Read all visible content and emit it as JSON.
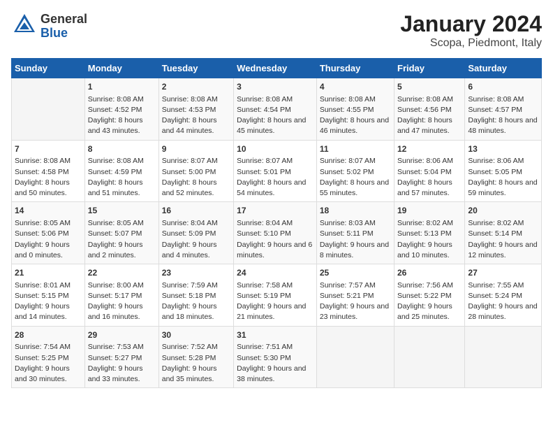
{
  "logo": {
    "general": "General",
    "blue": "Blue"
  },
  "title": "January 2024",
  "subtitle": "Scopa, Piedmont, Italy",
  "days_of_week": [
    "Sunday",
    "Monday",
    "Tuesday",
    "Wednesday",
    "Thursday",
    "Friday",
    "Saturday"
  ],
  "weeks": [
    [
      {
        "day": "",
        "sunrise": "",
        "sunset": "",
        "daylight": ""
      },
      {
        "day": "1",
        "sunrise": "Sunrise: 8:08 AM",
        "sunset": "Sunset: 4:52 PM",
        "daylight": "Daylight: 8 hours and 43 minutes."
      },
      {
        "day": "2",
        "sunrise": "Sunrise: 8:08 AM",
        "sunset": "Sunset: 4:53 PM",
        "daylight": "Daylight: 8 hours and 44 minutes."
      },
      {
        "day": "3",
        "sunrise": "Sunrise: 8:08 AM",
        "sunset": "Sunset: 4:54 PM",
        "daylight": "Daylight: 8 hours and 45 minutes."
      },
      {
        "day": "4",
        "sunrise": "Sunrise: 8:08 AM",
        "sunset": "Sunset: 4:55 PM",
        "daylight": "Daylight: 8 hours and 46 minutes."
      },
      {
        "day": "5",
        "sunrise": "Sunrise: 8:08 AM",
        "sunset": "Sunset: 4:56 PM",
        "daylight": "Daylight: 8 hours and 47 minutes."
      },
      {
        "day": "6",
        "sunrise": "Sunrise: 8:08 AM",
        "sunset": "Sunset: 4:57 PM",
        "daylight": "Daylight: 8 hours and 48 minutes."
      }
    ],
    [
      {
        "day": "7",
        "sunrise": "Sunrise: 8:08 AM",
        "sunset": "Sunset: 4:58 PM",
        "daylight": "Daylight: 8 hours and 50 minutes."
      },
      {
        "day": "8",
        "sunrise": "Sunrise: 8:08 AM",
        "sunset": "Sunset: 4:59 PM",
        "daylight": "Daylight: 8 hours and 51 minutes."
      },
      {
        "day": "9",
        "sunrise": "Sunrise: 8:07 AM",
        "sunset": "Sunset: 5:00 PM",
        "daylight": "Daylight: 8 hours and 52 minutes."
      },
      {
        "day": "10",
        "sunrise": "Sunrise: 8:07 AM",
        "sunset": "Sunset: 5:01 PM",
        "daylight": "Daylight: 8 hours and 54 minutes."
      },
      {
        "day": "11",
        "sunrise": "Sunrise: 8:07 AM",
        "sunset": "Sunset: 5:02 PM",
        "daylight": "Daylight: 8 hours and 55 minutes."
      },
      {
        "day": "12",
        "sunrise": "Sunrise: 8:06 AM",
        "sunset": "Sunset: 5:04 PM",
        "daylight": "Daylight: 8 hours and 57 minutes."
      },
      {
        "day": "13",
        "sunrise": "Sunrise: 8:06 AM",
        "sunset": "Sunset: 5:05 PM",
        "daylight": "Daylight: 8 hours and 59 minutes."
      }
    ],
    [
      {
        "day": "14",
        "sunrise": "Sunrise: 8:05 AM",
        "sunset": "Sunset: 5:06 PM",
        "daylight": "Daylight: 9 hours and 0 minutes."
      },
      {
        "day": "15",
        "sunrise": "Sunrise: 8:05 AM",
        "sunset": "Sunset: 5:07 PM",
        "daylight": "Daylight: 9 hours and 2 minutes."
      },
      {
        "day": "16",
        "sunrise": "Sunrise: 8:04 AM",
        "sunset": "Sunset: 5:09 PM",
        "daylight": "Daylight: 9 hours and 4 minutes."
      },
      {
        "day": "17",
        "sunrise": "Sunrise: 8:04 AM",
        "sunset": "Sunset: 5:10 PM",
        "daylight": "Daylight: 9 hours and 6 minutes."
      },
      {
        "day": "18",
        "sunrise": "Sunrise: 8:03 AM",
        "sunset": "Sunset: 5:11 PM",
        "daylight": "Daylight: 9 hours and 8 minutes."
      },
      {
        "day": "19",
        "sunrise": "Sunrise: 8:02 AM",
        "sunset": "Sunset: 5:13 PM",
        "daylight": "Daylight: 9 hours and 10 minutes."
      },
      {
        "day": "20",
        "sunrise": "Sunrise: 8:02 AM",
        "sunset": "Sunset: 5:14 PM",
        "daylight": "Daylight: 9 hours and 12 minutes."
      }
    ],
    [
      {
        "day": "21",
        "sunrise": "Sunrise: 8:01 AM",
        "sunset": "Sunset: 5:15 PM",
        "daylight": "Daylight: 9 hours and 14 minutes."
      },
      {
        "day": "22",
        "sunrise": "Sunrise: 8:00 AM",
        "sunset": "Sunset: 5:17 PM",
        "daylight": "Daylight: 9 hours and 16 minutes."
      },
      {
        "day": "23",
        "sunrise": "Sunrise: 7:59 AM",
        "sunset": "Sunset: 5:18 PM",
        "daylight": "Daylight: 9 hours and 18 minutes."
      },
      {
        "day": "24",
        "sunrise": "Sunrise: 7:58 AM",
        "sunset": "Sunset: 5:19 PM",
        "daylight": "Daylight: 9 hours and 21 minutes."
      },
      {
        "day": "25",
        "sunrise": "Sunrise: 7:57 AM",
        "sunset": "Sunset: 5:21 PM",
        "daylight": "Daylight: 9 hours and 23 minutes."
      },
      {
        "day": "26",
        "sunrise": "Sunrise: 7:56 AM",
        "sunset": "Sunset: 5:22 PM",
        "daylight": "Daylight: 9 hours and 25 minutes."
      },
      {
        "day": "27",
        "sunrise": "Sunrise: 7:55 AM",
        "sunset": "Sunset: 5:24 PM",
        "daylight": "Daylight: 9 hours and 28 minutes."
      }
    ],
    [
      {
        "day": "28",
        "sunrise": "Sunrise: 7:54 AM",
        "sunset": "Sunset: 5:25 PM",
        "daylight": "Daylight: 9 hours and 30 minutes."
      },
      {
        "day": "29",
        "sunrise": "Sunrise: 7:53 AM",
        "sunset": "Sunset: 5:27 PM",
        "daylight": "Daylight: 9 hours and 33 minutes."
      },
      {
        "day": "30",
        "sunrise": "Sunrise: 7:52 AM",
        "sunset": "Sunset: 5:28 PM",
        "daylight": "Daylight: 9 hours and 35 minutes."
      },
      {
        "day": "31",
        "sunrise": "Sunrise: 7:51 AM",
        "sunset": "Sunset: 5:30 PM",
        "daylight": "Daylight: 9 hours and 38 minutes."
      },
      {
        "day": "",
        "sunrise": "",
        "sunset": "",
        "daylight": ""
      },
      {
        "day": "",
        "sunrise": "",
        "sunset": "",
        "daylight": ""
      },
      {
        "day": "",
        "sunrise": "",
        "sunset": "",
        "daylight": ""
      }
    ]
  ]
}
